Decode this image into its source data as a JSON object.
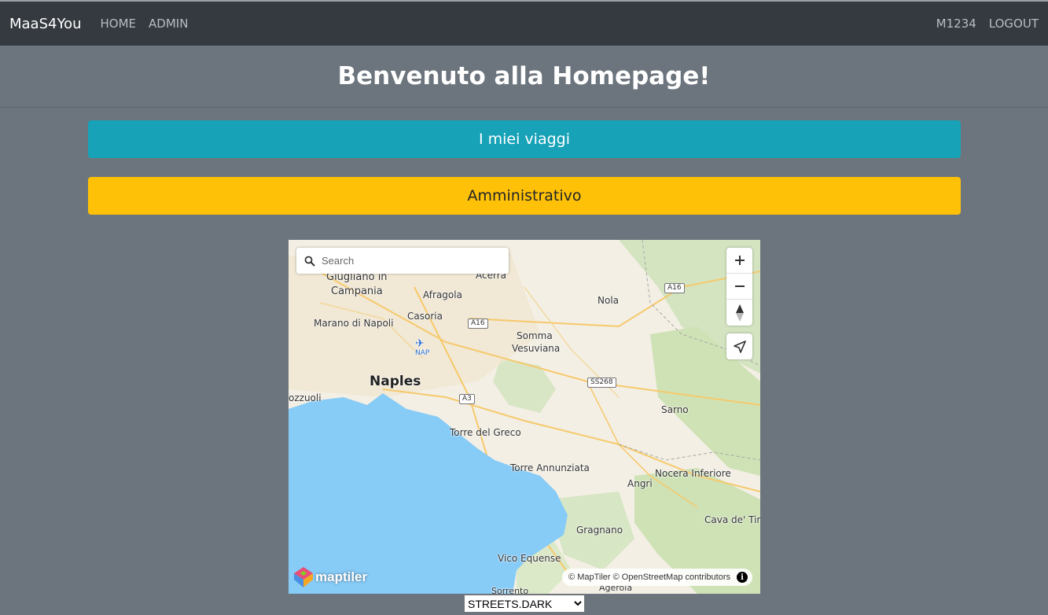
{
  "navbar": {
    "brand": "MaaS4You",
    "links": [
      "HOME",
      "ADMIN"
    ],
    "user": "M1234",
    "logout": "LOGOUT"
  },
  "page": {
    "title": "Benvenuto alla Homepage!"
  },
  "buttons": {
    "trips": "I miei viaggi",
    "admin": "Amministrativo"
  },
  "colors": {
    "navbar_bg": "#343a40",
    "page_bg": "#6c757d",
    "trips_btn": "#17a2b8",
    "admin_btn": "#ffc107"
  },
  "map": {
    "search_placeholder": "Search",
    "places": {
      "giugliano": "Giugliano in",
      "campania": "Campania",
      "acerra": "Acerra",
      "afragola": "Afragola",
      "nola": "Nola",
      "marano": "Marano di Napoli",
      "casoria": "Casoria",
      "somma": "Somma",
      "vesuviana": "Vesuviana",
      "nap": "NAP",
      "naples": "Naples",
      "pozzuoli": "ozzuoli",
      "sarno": "Sarno",
      "torre_greco": "Torre del Greco",
      "torre_annunziata": "Torre Annunziata",
      "nocera": "Nocera Inferiore",
      "angri": "Angri",
      "cava": "Cava de' Tirr",
      "gragnano": "Gragnano",
      "vico": "Vico Equense",
      "agerola": "Agerola",
      "sorrento": "Sorrento"
    },
    "roads": {
      "a16_top": "A16",
      "a16_mid": "A16",
      "ss268": "SS268",
      "a3": "A3"
    },
    "icons": {
      "search": "search-icon",
      "zoom_in": "plus-icon",
      "zoom_out": "minus-icon",
      "compass": "compass-icon",
      "geolocate": "location-arrow-icon",
      "info": "info-icon",
      "airport": "airplane-icon"
    },
    "logo_text": "maptiler",
    "attribution": "© MapTiler © OpenStreetMap contributors",
    "info_glyph": "i"
  },
  "style_select": {
    "selected": "STREETS.DARK"
  }
}
